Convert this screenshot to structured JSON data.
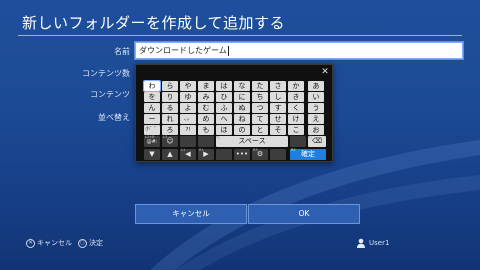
{
  "dialog": {
    "title": "新しいフォルダーを作成して追加する"
  },
  "form": {
    "name_label": "名前",
    "name_value": "ダウンロードしたゲーム",
    "contents_count_label": "コンテンツ数",
    "contents_label": "コンテンツ",
    "sort_label": "並べ替え"
  },
  "keyboard": {
    "close_label": "✕",
    "rows": [
      [
        "わ",
        "ら",
        "や",
        "ま",
        "は",
        "な",
        "た",
        "さ",
        "か",
        "あ"
      ],
      [
        "を",
        "り",
        "ゆ",
        "み",
        "ひ",
        "に",
        "ち",
        "し",
        "き",
        "い"
      ],
      [
        "ん",
        "る",
        "よ",
        "む",
        "ふ",
        "ぬ",
        "つ",
        "す",
        "く",
        "う"
      ],
      [
        "ー",
        "れ",
        "、。",
        "め",
        "へ",
        "ね",
        "て",
        "せ",
        "け",
        "え"
      ],
      [
        "小゛゜",
        "ろ",
        "?!",
        "も",
        "ほ",
        "の",
        "と",
        "そ",
        "こ",
        "お"
      ]
    ],
    "mode_key": "L2+R",
    "mode_sub": "@#:",
    "mode_key2": "L3",
    "space_key": "スペース",
    "space_tag": "△",
    "backspace_tag": "□",
    "confirm_key": "確定",
    "confirm_tag": "R2",
    "more_key": "•••",
    "l1_tag": "L1",
    "r1_tag": "R1",
    "r3_tag": "R3"
  },
  "buttons": {
    "cancel_label": "キャンセル",
    "ok_label": "OK"
  },
  "footer": {
    "cancel_symbol": "✕",
    "cancel_label": "キャンセル",
    "confirm_symbol": "○",
    "confirm_label": "決定",
    "user_label": "User1"
  },
  "colors": {
    "background": "#1c4a96",
    "accent": "#1e7fe0",
    "keyboard_bg": "#101010"
  }
}
